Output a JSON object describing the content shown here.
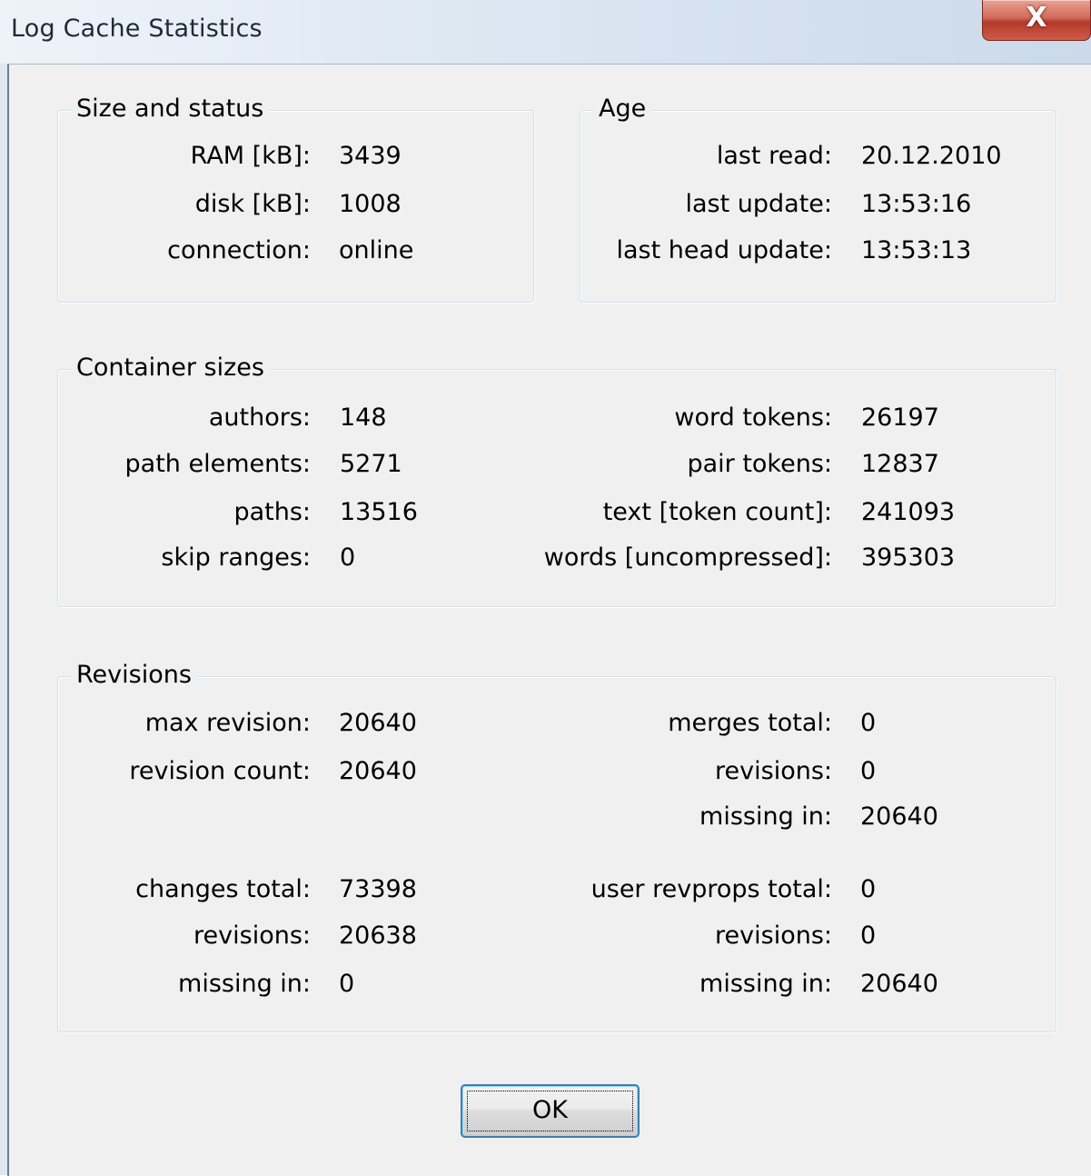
{
  "window": {
    "title": "Log Cache Statistics",
    "close_glyph": "X"
  },
  "size_status": {
    "title": "Size and status",
    "ram_label": "RAM [kB]:",
    "ram_value": "3439",
    "disk_label": "disk [kB]:",
    "disk_value": "1008",
    "connection_label": "connection:",
    "connection_value": "online"
  },
  "age": {
    "title": "Age",
    "last_read_label": "last read:",
    "last_read_value": "20.12.2010",
    "last_update_label": "last update:",
    "last_update_value": "13:53:16",
    "last_head_update_label": "last head update:",
    "last_head_update_value": "13:53:13"
  },
  "container": {
    "title": "Container sizes",
    "authors_label": "authors:",
    "authors_value": "148",
    "path_elements_label": "path elements:",
    "path_elements_value": "5271",
    "paths_label": "paths:",
    "paths_value": "13516",
    "skip_ranges_label": "skip ranges:",
    "skip_ranges_value": "0",
    "word_tokens_label": "word tokens:",
    "word_tokens_value": "26197",
    "pair_tokens_label": "pair tokens:",
    "pair_tokens_value": "12837",
    "text_label": "text [token count]:",
    "text_value": "241093",
    "words_label": "words [uncompressed]:",
    "words_value": "395303"
  },
  "revisions": {
    "title": "Revisions",
    "max_revision_label": "max revision:",
    "max_revision_value": "20640",
    "revision_count_label": "revision count:",
    "revision_count_value": "20640",
    "changes_total_label": "changes total:",
    "changes_total_value": "73398",
    "changes_revisions_label": "revisions:",
    "changes_revisions_value": "20638",
    "changes_missing_label": "missing in:",
    "changes_missing_value": "0",
    "merges_total_label": "merges total:",
    "merges_total_value": "0",
    "merges_revisions_label": "revisions:",
    "merges_revisions_value": "0",
    "merges_missing_label": "missing in:",
    "merges_missing_value": "20640",
    "revprops_total_label": "user revprops total:",
    "revprops_total_value": "0",
    "revprops_revisions_label": "revisions:",
    "revprops_revisions_value": "0",
    "revprops_missing_label": "missing in:",
    "revprops_missing_value": "20640"
  },
  "buttons": {
    "ok_label": "OK"
  }
}
